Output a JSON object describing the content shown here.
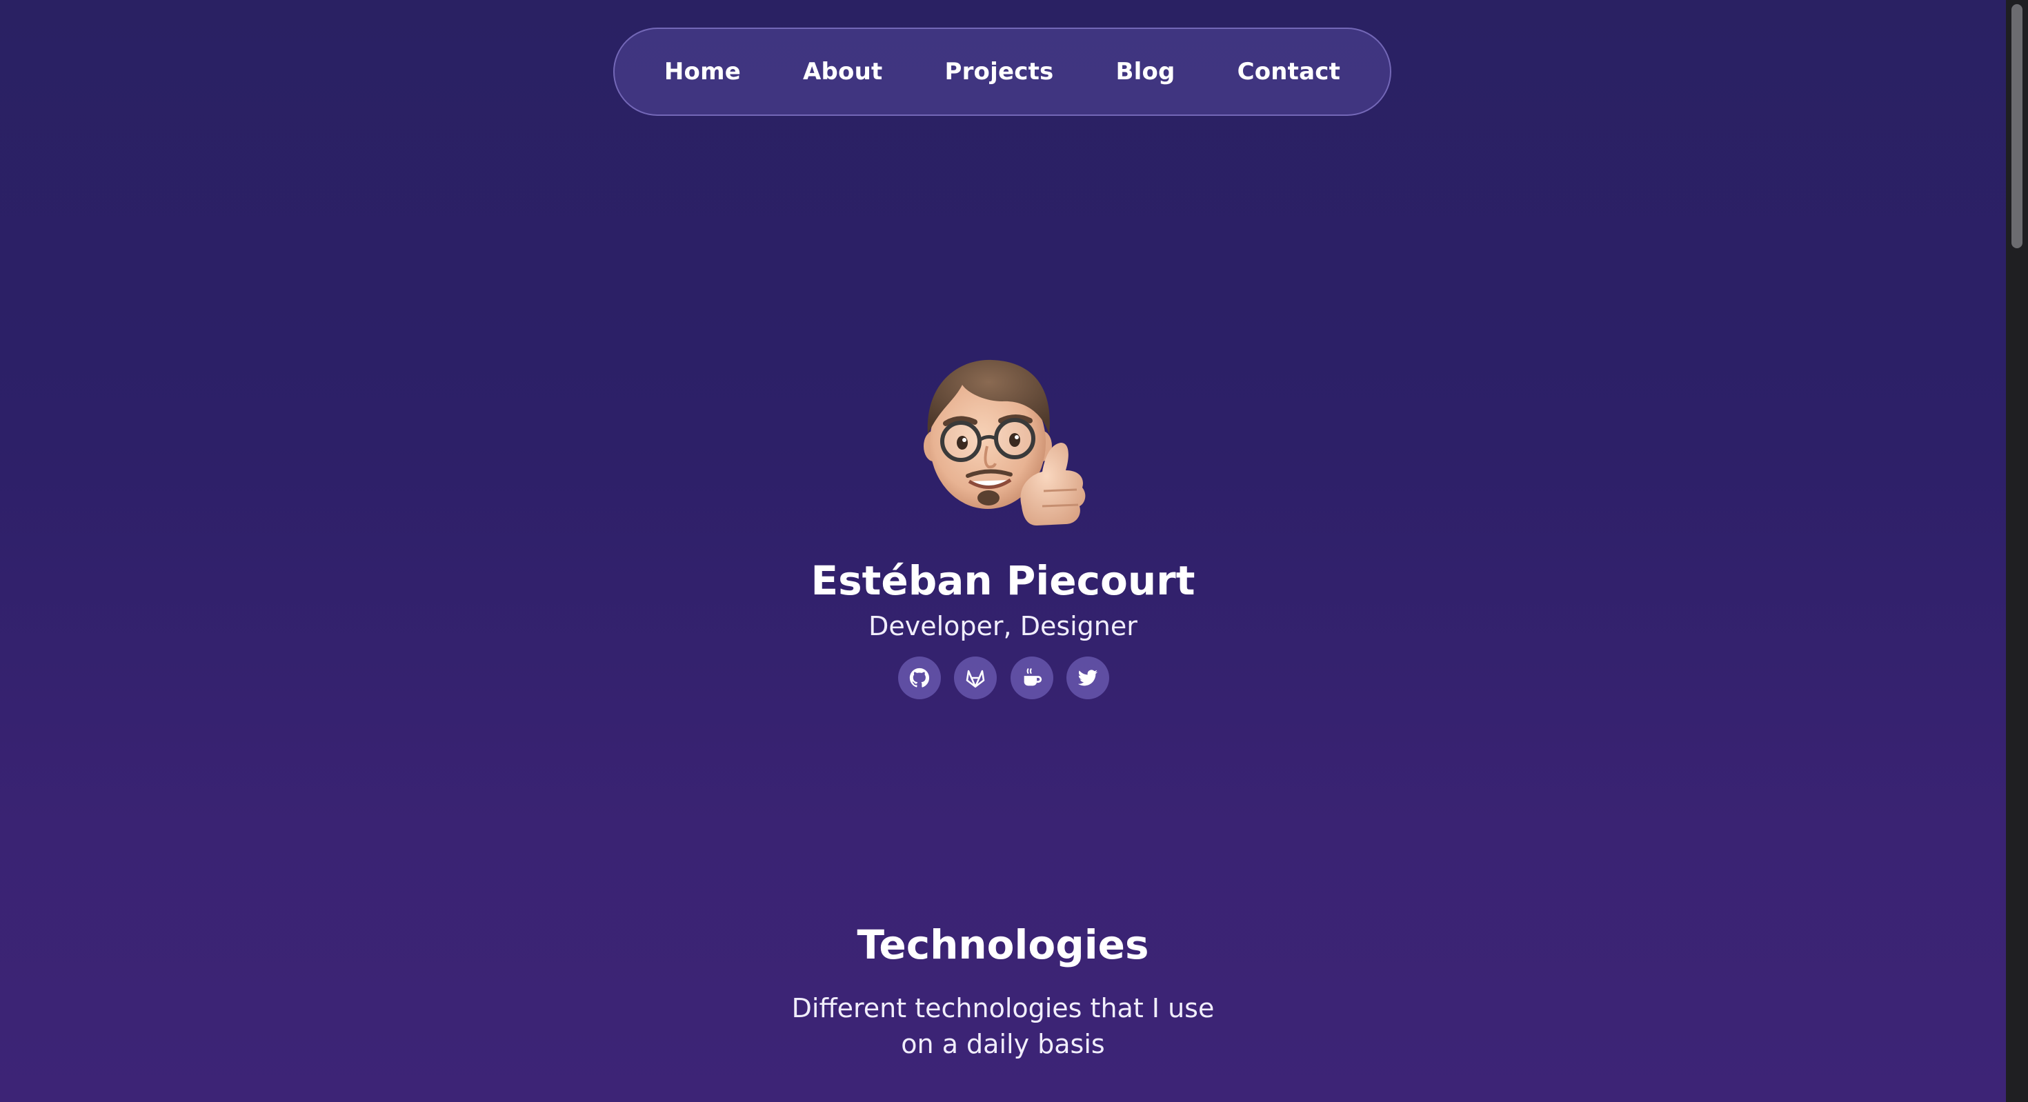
{
  "nav": {
    "items": [
      {
        "label": "Home"
      },
      {
        "label": "About"
      },
      {
        "label": "Projects"
      },
      {
        "label": "Blog"
      },
      {
        "label": "Contact"
      }
    ]
  },
  "hero": {
    "avatar_icon": "memoji-thumbs-up-icon",
    "name": "Estéban Piecourt",
    "role": "Developer, Designer",
    "socials": [
      {
        "icon": "github-icon"
      },
      {
        "icon": "gitlab-icon"
      },
      {
        "icon": "coffee-icon"
      },
      {
        "icon": "twitter-icon"
      }
    ]
  },
  "technologies": {
    "title": "Technologies",
    "subtitle_line1": "Different technologies that I use",
    "subtitle_line2": "on a daily basis"
  },
  "colors": {
    "background_top": "#2a2163",
    "background_bottom": "#3d2476",
    "nav_background": "#4a3f8c",
    "social_button": "#5d4f9c",
    "text": "#ffffff"
  }
}
